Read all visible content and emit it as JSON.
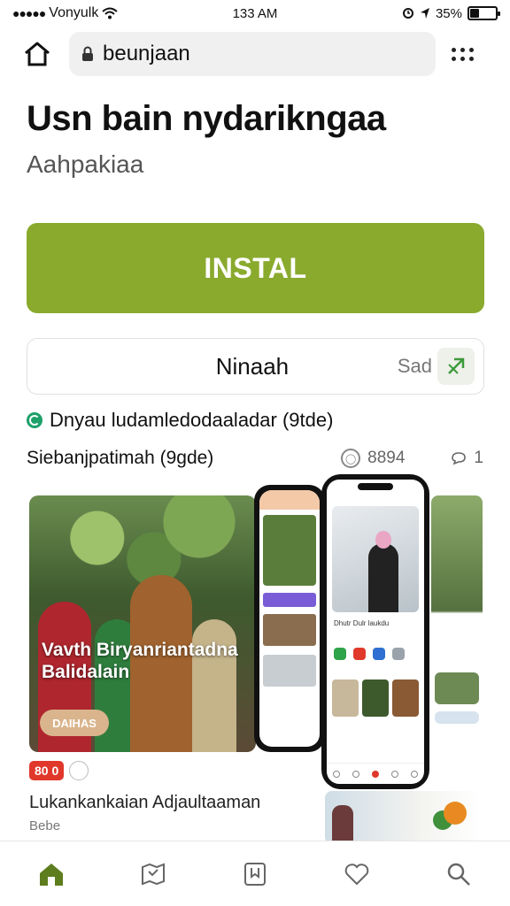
{
  "status_bar": {
    "carrier": "Vonyulk",
    "time": "133 AM",
    "battery": "35%",
    "battery_level": 0.35
  },
  "browser": {
    "url": "beunjaan"
  },
  "app": {
    "title": "Usn bain nydarikngaa",
    "subtitle": "Aahpakiaa",
    "install_label": "INSTAL",
    "secondary_label": "Ninaah",
    "share_label": "Sad"
  },
  "info": {
    "developer_line": "Dnyau ludamledodaaladar (9tde)",
    "meta_line": "Siebanjpatimah (9gde)",
    "rating": "8894",
    "reviews": "1"
  },
  "gallery": {
    "main_overlay": "Vavth Biryanriantadna Balidalain",
    "main_chip": "DAIHAS",
    "phone_caption": "Dhutr Dulr laukdu",
    "caption_badge": "80 0",
    "caption": "Lukankankaian Adjaultaaman",
    "subcaption": "Bebe"
  },
  "colors": {
    "accent": "#8aaa2e",
    "nav_active": "#5e7d1f"
  },
  "icons": {
    "home": "home-icon",
    "lock": "lock-icon",
    "more": "more-icon",
    "share": "share-icon",
    "nav": [
      "home-icon",
      "map-icon",
      "book-icon",
      "heart-icon",
      "search-icon"
    ]
  }
}
